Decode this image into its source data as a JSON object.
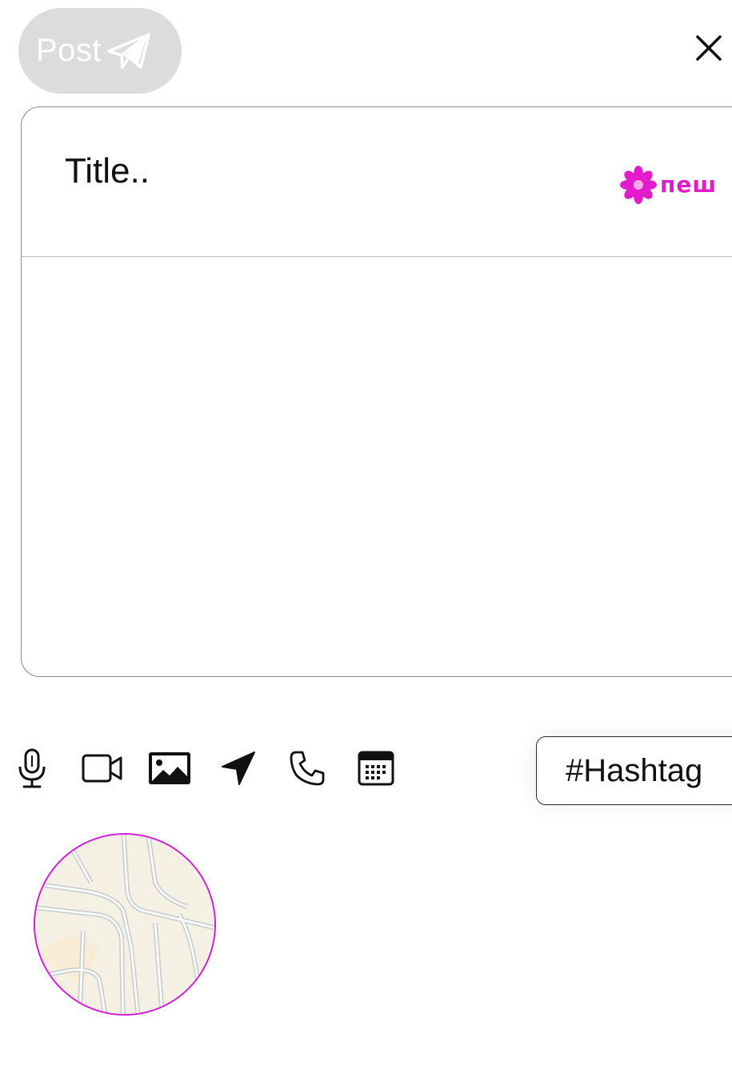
{
  "header": {
    "post_label": "Post",
    "post_icon": "paper-plane-icon",
    "close_icon": "close-icon"
  },
  "composer": {
    "title_placeholder": "Title..",
    "body_value": "",
    "new_badge_text": "пеш",
    "new_badge_icon": "flower-icon"
  },
  "toolbar": {
    "tools": [
      {
        "name": "microphone-icon"
      },
      {
        "name": "video-camera-icon"
      },
      {
        "name": "image-icon"
      },
      {
        "name": "location-arrow-icon"
      },
      {
        "name": "phone-icon"
      },
      {
        "name": "calendar-icon"
      }
    ],
    "hashtag_label": "#Hashtag"
  },
  "colors": {
    "post_button_bg": "#dcdcdc",
    "badge_accent": "#e31bcb",
    "map_border": "#d21ad8",
    "map_bg": "#f4f0e4"
  }
}
